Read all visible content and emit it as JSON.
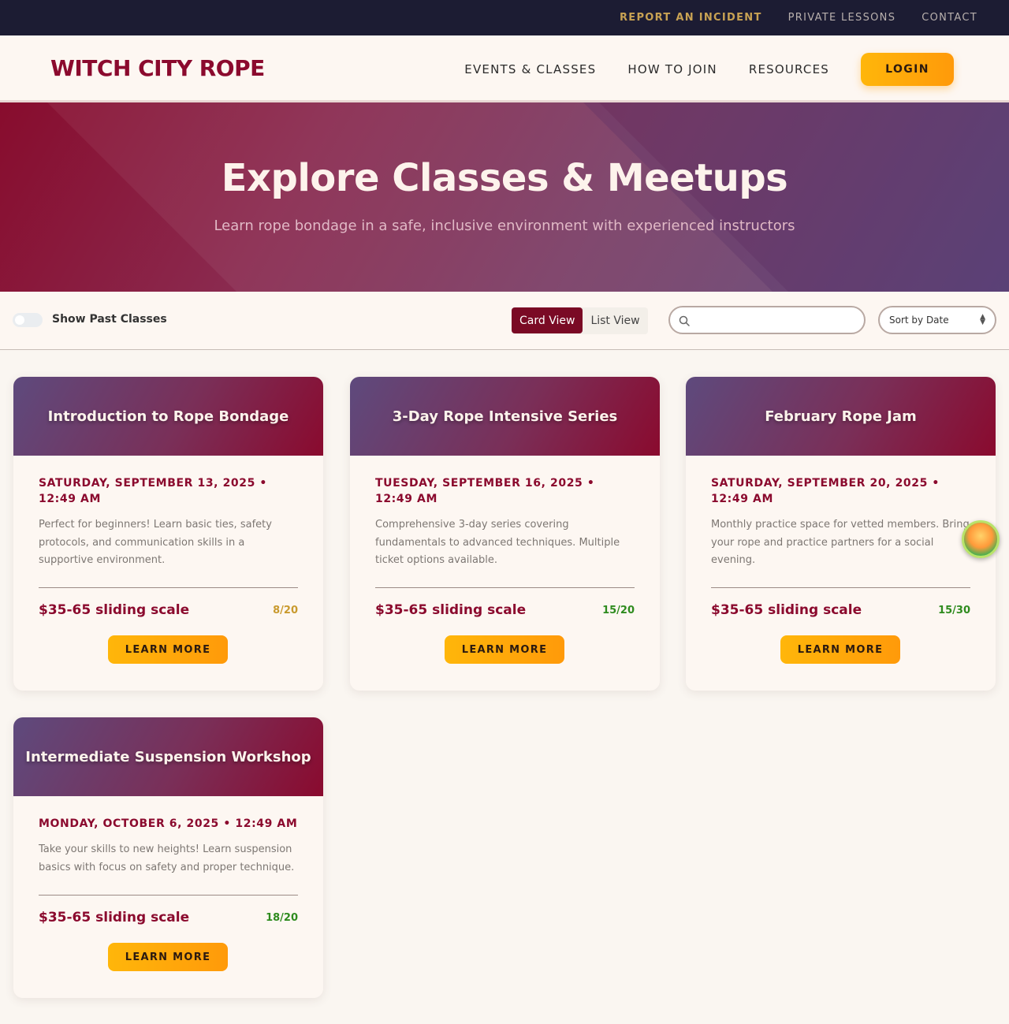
{
  "utility_nav": [
    {
      "label": "REPORT AN INCIDENT"
    },
    {
      "label": "PRIVATE LESSONS"
    },
    {
      "label": "CONTACT"
    }
  ],
  "header": {
    "logo": "WITCH CITY ROPE",
    "nav": [
      {
        "label": "EVENTS & CLASSES"
      },
      {
        "label": "HOW TO JOIN"
      },
      {
        "label": "RESOURCES"
      }
    ],
    "login_label": "LOGIN"
  },
  "hero": {
    "title": "Explore Classes & Meetups",
    "subtitle": "Learn rope bondage in a safe, inclusive environment with experienced instructors"
  },
  "filters": {
    "show_past_label": "Show Past Classes",
    "show_past_enabled": false,
    "views": [
      {
        "label": "Card View",
        "active": true
      },
      {
        "label": "List View",
        "active": false
      }
    ],
    "search": {
      "value": "",
      "placeholder": ""
    },
    "sort_selected": "Sort by Date"
  },
  "events": [
    {
      "title": "Introduction to Rope Bondage",
      "date": "SATURDAY, SEPTEMBER 13, 2025 • 12:49 AM",
      "description": "Perfect for beginners! Learn basic ties, safety protocols, and communication skills in a supportive environment.",
      "price": "$35-65 sliding scale",
      "capacity": "8/20",
      "capacity_color": "#c99a2e",
      "cta": "LEARN MORE"
    },
    {
      "title": "3-Day Rope Intensive Series",
      "date": "TUESDAY, SEPTEMBER 16, 2025 • 12:49 AM",
      "description": "Comprehensive 3-day series covering fundamentals to advanced techniques. Multiple ticket options available.",
      "price": "$35-65 sliding scale",
      "capacity": "15/20",
      "capacity_color": "#2e8b1e",
      "cta": "LEARN MORE"
    },
    {
      "title": "February Rope Jam",
      "date": "SATURDAY, SEPTEMBER 20, 2025 • 12:49 AM",
      "description": "Monthly practice space for vetted members. Bring your rope and practice partners for a social evening.",
      "price": "$35-65 sliding scale",
      "capacity": "15/30",
      "capacity_color": "#2e8b1e",
      "cta": "LEARN MORE"
    },
    {
      "title": "Intermediate Suspension Workshop",
      "date": "MONDAY, OCTOBER 6, 2025 • 12:49 AM",
      "description": "Take your skills to new heights! Learn suspension basics with focus on safety and proper technique.",
      "price": "$35-65 sliding scale",
      "capacity": "18/20",
      "capacity_color": "#2e8b1e",
      "cta": "LEARN MORE"
    }
  ],
  "colors": {
    "brand": "#8b0a2e",
    "accent": "#ffb60a",
    "topbar": "#1c1c33"
  }
}
